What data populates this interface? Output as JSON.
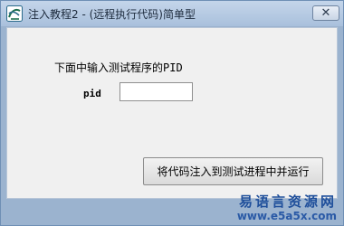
{
  "window": {
    "title": "注入教程2 - (远程执行代码)简单型",
    "close_glyph": "✕",
    "icon": "app-logo-icon"
  },
  "form": {
    "instruction": "下面中输入测试程序的PID",
    "pid_label": "pid",
    "pid_value": "",
    "run_button_label": "将代码注入到测试进程中并运行"
  },
  "watermark": {
    "site_name": "易语言资源网",
    "site_url": "www.e5a5x.com"
  },
  "colors": {
    "frame": "#9bb3cf",
    "client": "#f0f0f0",
    "watermark": "#1f4f9b"
  }
}
